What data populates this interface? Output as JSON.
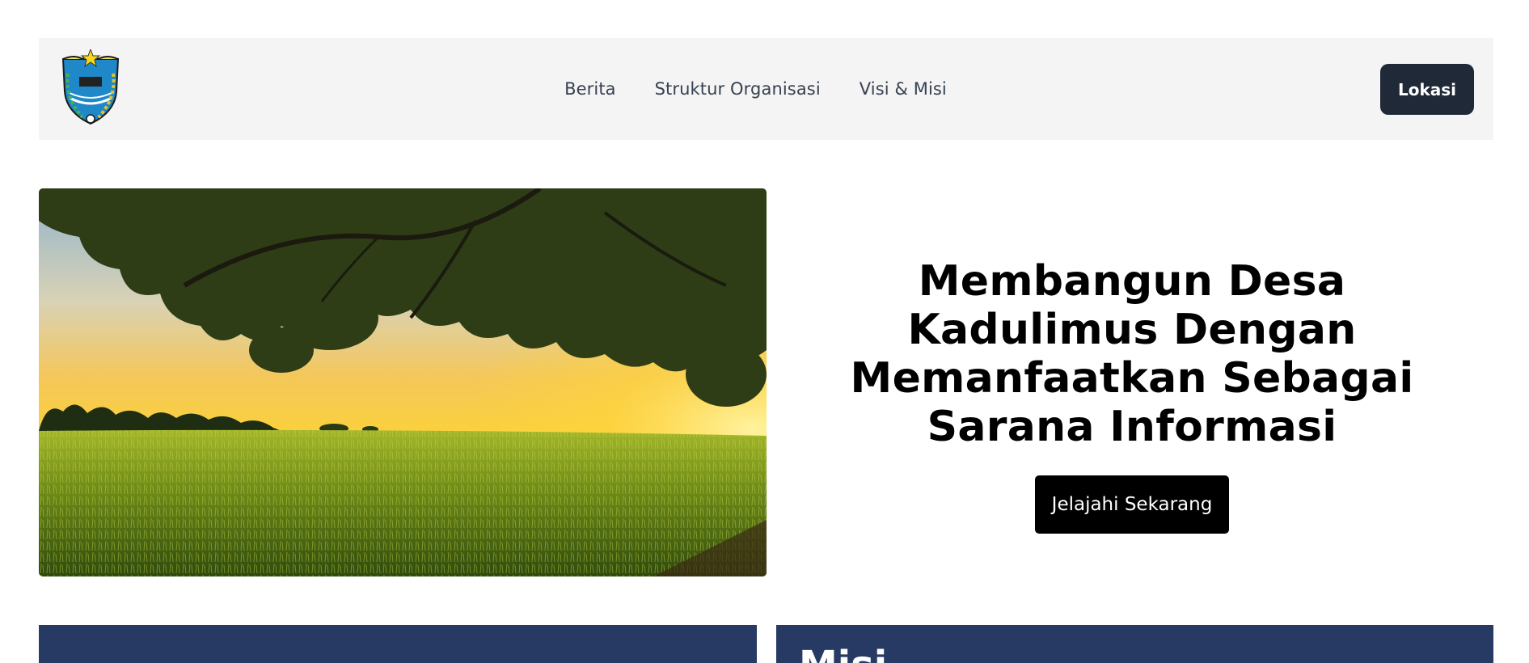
{
  "nav": {
    "logo_name": "village-emblem-logo",
    "links": [
      "Berita",
      "Struktur Organisasi",
      "Visi & Misi"
    ],
    "location_button": "Lokasi"
  },
  "hero": {
    "title": "Membangun Desa Kadulimus Dengan Memanfaatkan Sebagai Sarana Informasi",
    "cta_button": "Jelajahi Sekarang",
    "image_name": "grassland-sunset-tree-photo"
  },
  "sections": {
    "left_title": "",
    "right_title": "Misi",
    "color": "#263a63"
  }
}
